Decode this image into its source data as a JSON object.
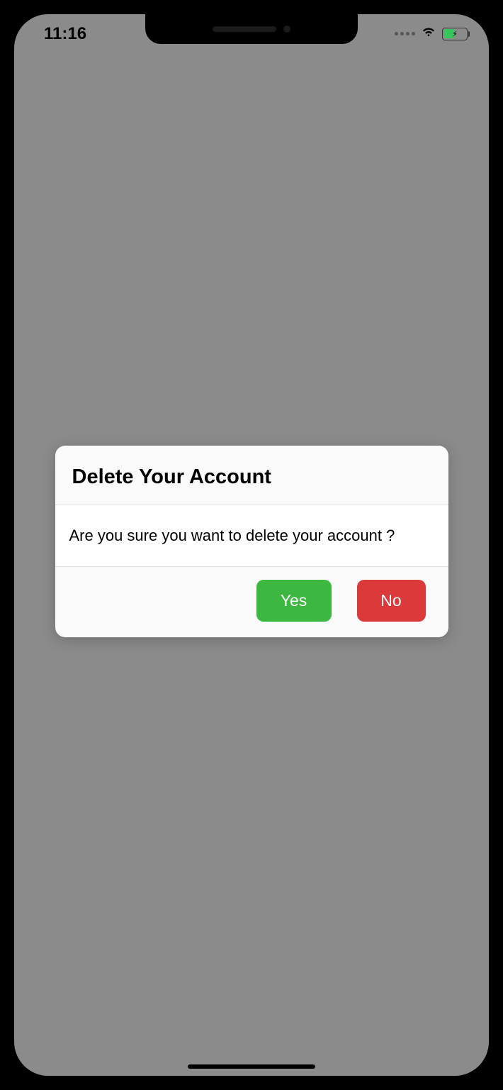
{
  "statusBar": {
    "time": "11:16"
  },
  "dialog": {
    "title": "Delete Your Account",
    "message": "Are you sure you want to delete your account ?",
    "confirmLabel": "Yes",
    "cancelLabel": "No"
  }
}
